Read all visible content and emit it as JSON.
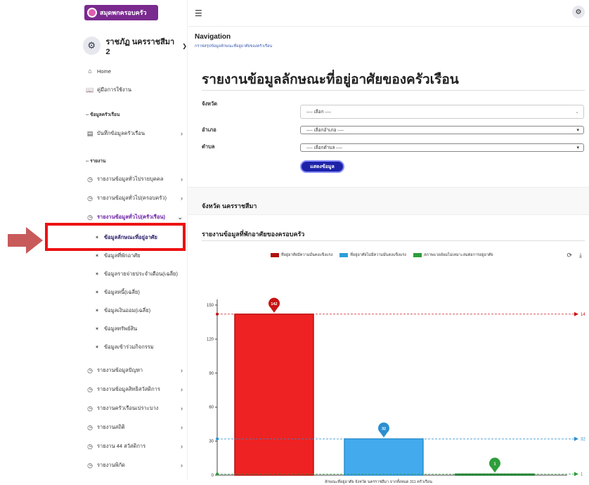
{
  "app": {
    "logo_text": "สมุดพกครอบครัว",
    "user_name": "ราชภัฏ นครราชสีมา 2"
  },
  "sidebar": {
    "items": [
      {
        "label": "Home",
        "icon": "home-icon"
      },
      {
        "label": "คู่มือการใช้งาน",
        "icon": "book-icon"
      }
    ],
    "section_family": "-- ข้อมูลครัวเรือน",
    "record_family": "บันทึกข้อมูลครัวเรือน",
    "section_report": "-- รายงาน",
    "reports": [
      "รายงานข้อมูลทั่วไปรายบุคคล",
      "รายงานข้อมูลทั่วไป(ครอบครัว)",
      "รายงานข้อมูลทั่วไป(ครัวเรือน)"
    ],
    "sub_items": [
      "ข้อมูลลักษณะที่อยู่อาศัย",
      "ข้อมูลที่พักอาศัย",
      "ข้อมูลรายจ่ายประจำเดือน(เฉลี่ย)",
      "ข้อมูลหนี้(เฉลี่ย)",
      "ข้อมูลเงินออม(เฉลี่ย)",
      "ข้อมูลทรัพย์สิน",
      "ข้อมูลเข้าร่วมกิจกรรม"
    ],
    "more_reports": [
      "รายงานข้อมูลปัญหา",
      "รายงานข้อมูลสิทธิสวัสดิการ",
      "รายงานครัวเรือนเปราะบาง",
      "รายงานสถิติ",
      "รายงาน 44 สวัสดิการ",
      "รายงานพิกัด"
    ]
  },
  "breadcrumb": {
    "title": "Navigation",
    "subtitle": "กราฟสรุปข้อมูลลักษณะที่อยู่อาศัยของครัวเรือน"
  },
  "page": {
    "title": "รายงานข้อมูลลักษณะที่อยู่อาศัยของครัวเรือน",
    "province_label": "จังหวัด",
    "province_value": "---- เลือก ----",
    "district_label": "อำเภอ",
    "district_value": "---- เลือกอำเภอ ----",
    "subdistrict_label": "ตำบล",
    "subdistrict_value": "---- เลือกตำบล ----",
    "show_button": "แสดงข้อมูล",
    "province_heading": "จังหวัด นครราชสีมา",
    "report_heading": "รายงานข้อมูลที่พักอาศัยของครอบครัว"
  },
  "chart_data": {
    "type": "bar",
    "categories": [
      "ที่อยู่อาศัยมีความมั่นคงแข็งแรง",
      "ที่อยู่อาศัยไม่มีความมั่นคงแข็งแรง",
      "สภาพแวดล้อมไม่เหมาะสมต่อการอยู่อาศัย"
    ],
    "values": [
      142,
      32,
      1
    ],
    "colors": [
      "#ee2222",
      "#44aaee",
      "#22aa44"
    ],
    "marker_colors": [
      "#c91414",
      "#2a8fd0",
      "#2e9e3a"
    ],
    "line_colors": [
      "#c91414",
      "#2a8fd0",
      "#2e9e3a"
    ],
    "ylim": [
      0,
      150
    ],
    "yticks": [
      0,
      30,
      60,
      90,
      120,
      150
    ],
    "ref_labels": [
      "14",
      "32",
      "1"
    ],
    "xlabel": "ลักษณะที่อยู่อาศัย จังหวัด นครราชสีมา จากทั้งหมด 311 ครัวเรือน",
    "grid": false,
    "legend": "top"
  }
}
